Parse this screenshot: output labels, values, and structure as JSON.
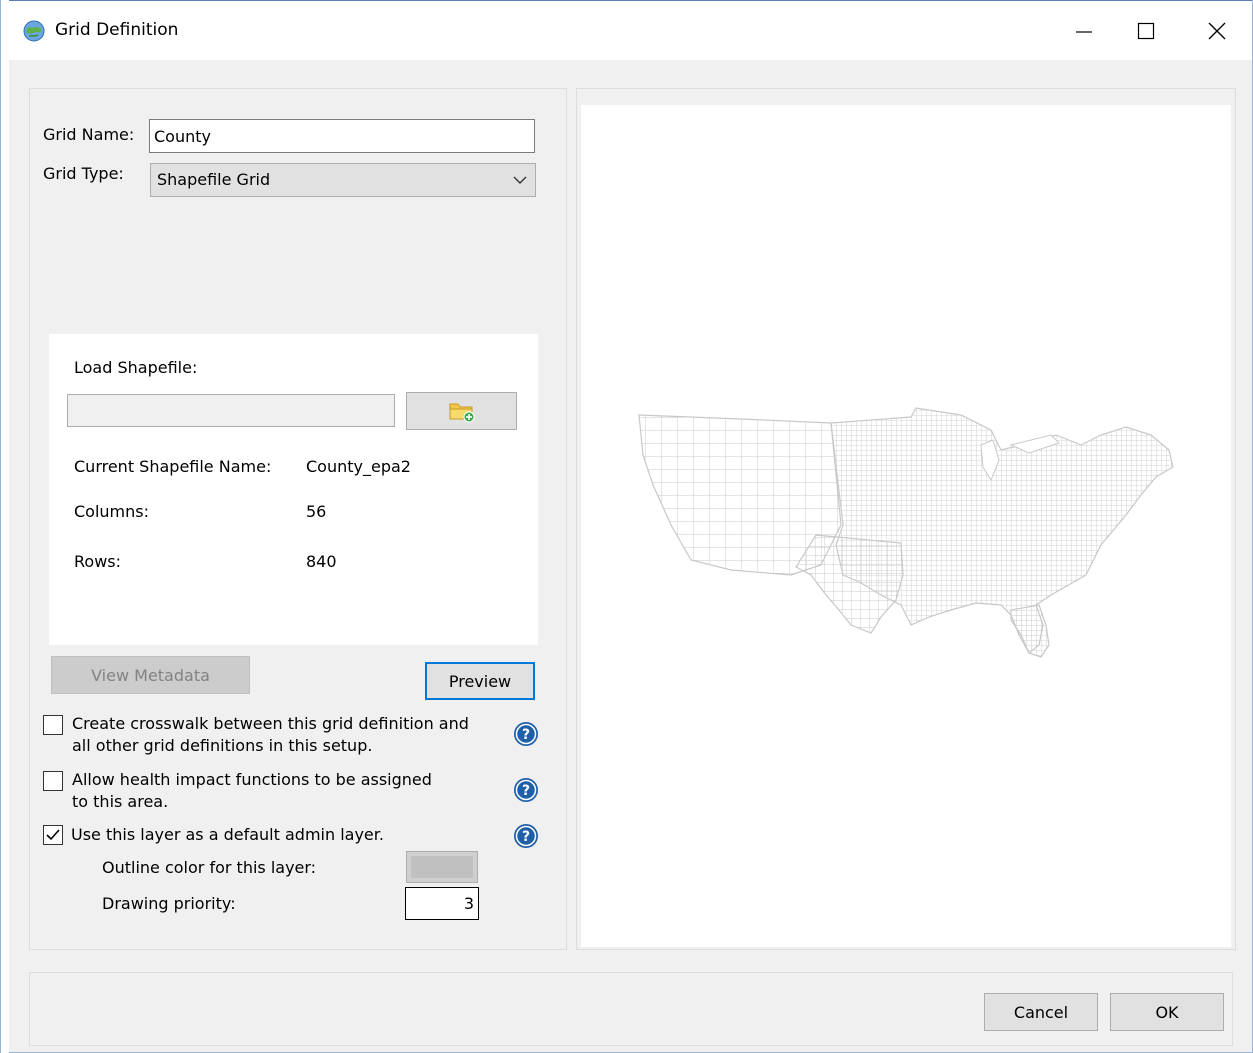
{
  "window": {
    "title": "Grid Definition",
    "controls": {
      "minimize": "minimize",
      "maximize": "maximize",
      "close": "close"
    }
  },
  "form": {
    "grid_name_label": "Grid Name:",
    "grid_name_value": "County",
    "grid_type_label": "Grid Type:",
    "grid_type_value": "Shapefile Grid"
  },
  "shapefile": {
    "load_label": "Load Shapefile:",
    "path_value": "",
    "browse_icon": "folder-add-icon",
    "current_name_label": "Current Shapefile Name:",
    "current_name_value": "County_epa2",
    "columns_label": "Columns:",
    "columns_value": "56",
    "rows_label": "Rows:",
    "rows_value": "840"
  },
  "buttons": {
    "view_metadata": "View Metadata",
    "preview": "Preview",
    "cancel": "Cancel",
    "ok": "OK"
  },
  "options": {
    "crosswalk_line1": "Create crosswalk between this grid definition and",
    "crosswalk_line2": "all other grid definitions in this setup.",
    "crosswalk_checked": false,
    "hif_line1": "Allow health impact functions to be assigned",
    "hif_line2": "to this area.",
    "hif_checked": false,
    "admin_layer": "Use this layer as a default admin layer.",
    "admin_checked": true,
    "outline_color_label": "Outline color for this layer:",
    "outline_color": "#c0c0c0",
    "drawing_priority_label": "Drawing priority:",
    "drawing_priority_value": "3"
  },
  "colors": {
    "focus_border": "#0078d7",
    "help_icon": "#1f5fa8",
    "map_lines": "#c8c8c8"
  }
}
